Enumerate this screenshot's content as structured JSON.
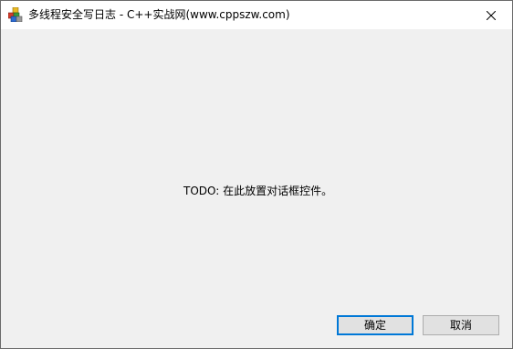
{
  "window": {
    "title": "多线程安全写日志  - C++实战网(www.cppszw.com)",
    "icon": "app-cubes-icon",
    "close_icon": "close-icon"
  },
  "content": {
    "placeholder_text": "TODO: 在此放置对话框控件。"
  },
  "buttons": {
    "ok_label": "确定",
    "cancel_label": "取消"
  },
  "colors": {
    "titlebar_bg": "#ffffff",
    "client_bg": "#f0f0f0",
    "default_button_border": "#0078d7",
    "button_bg": "#e1e1e1"
  }
}
